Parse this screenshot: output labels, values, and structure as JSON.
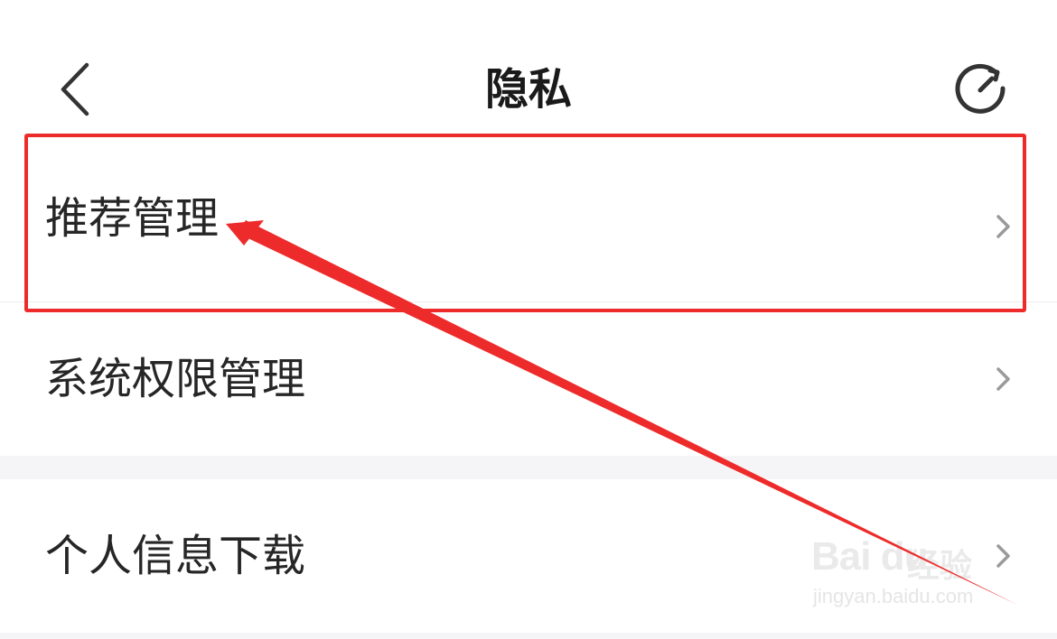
{
  "header": {
    "title": "隐私",
    "back_icon": "chevron-left-icon",
    "refresh_icon": "refresh-icon"
  },
  "settings": {
    "items": [
      {
        "label": "推荐管理",
        "icon": "chevron-right-icon"
      },
      {
        "label": "系统权限管理",
        "icon": "chevron-right-icon"
      },
      {
        "label": "个人信息下载",
        "icon": "chevron-right-icon"
      }
    ]
  },
  "annotation": {
    "color": "#ee2b2b"
  },
  "watermark": {
    "brand": "Bai du",
    "brand_suffix": "经验",
    "url": "jingyan.baidu.com"
  }
}
